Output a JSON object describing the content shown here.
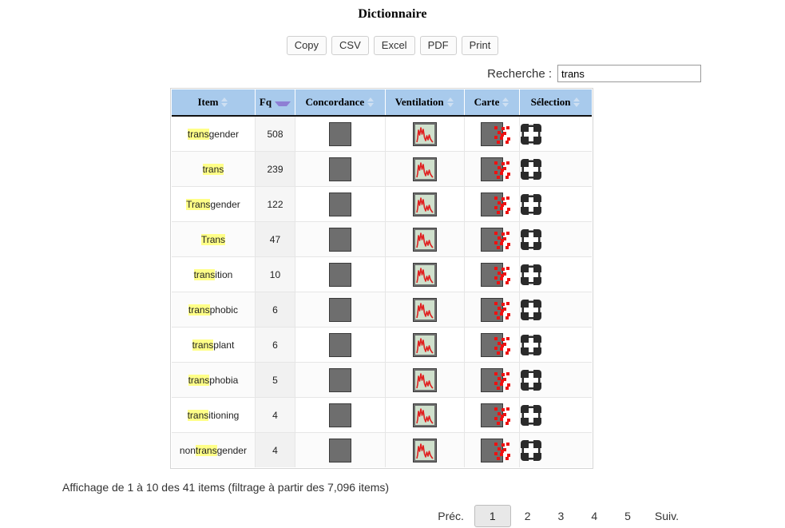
{
  "page": {
    "title": "Dictionnaire"
  },
  "toolbar": {
    "buttons": [
      {
        "label": "Copy",
        "name": "copy-button"
      },
      {
        "label": "CSV",
        "name": "csv-button"
      },
      {
        "label": "Excel",
        "name": "excel-button"
      },
      {
        "label": "PDF",
        "name": "pdf-button"
      },
      {
        "label": "Print",
        "name": "print-button"
      }
    ]
  },
  "search": {
    "label": "Recherche :",
    "value": "trans",
    "placeholder": ""
  },
  "table": {
    "columns": [
      {
        "label": "Item",
        "sort": "both"
      },
      {
        "label": "Fq",
        "sort": "desc"
      },
      {
        "label": "Concordance",
        "sort": "both"
      },
      {
        "label": "Ventilation",
        "sort": "both"
      },
      {
        "label": "Carte",
        "sort": "both"
      },
      {
        "label": "Sélection",
        "sort": "both"
      }
    ],
    "highlight_term": "trans",
    "rows": [
      {
        "item_pre": "",
        "item_hl": "trans",
        "item_post": "gender",
        "fq": "508"
      },
      {
        "item_pre": "",
        "item_hl": "trans",
        "item_post": "",
        "fq": "239"
      },
      {
        "item_pre": "",
        "item_hl": "Trans",
        "item_post": "gender",
        "fq": "122"
      },
      {
        "item_pre": "",
        "item_hl": "Trans",
        "item_post": "",
        "fq": "47"
      },
      {
        "item_pre": "",
        "item_hl": "trans",
        "item_post": "ition",
        "fq": "10"
      },
      {
        "item_pre": "",
        "item_hl": "trans",
        "item_post": "phobic",
        "fq": "6"
      },
      {
        "item_pre": "",
        "item_hl": "trans",
        "item_post": "plant",
        "fq": "6"
      },
      {
        "item_pre": "",
        "item_hl": "trans",
        "item_post": "phobia",
        "fq": "5"
      },
      {
        "item_pre": "",
        "item_hl": "trans",
        "item_post": "itioning",
        "fq": "4"
      },
      {
        "item_pre": "non",
        "item_hl": "trans",
        "item_post": "gender",
        "fq": "4"
      }
    ],
    "icons": {
      "concordance": "concordance-icon",
      "ventilation": "ventilation-icon",
      "carte": "carte-icon",
      "selection": "selection-icon"
    }
  },
  "footer": {
    "info": "Affichage de 1 à 10 des 41 items (filtrage à partir des 7,096 items)",
    "pagination": {
      "previous": "Préc.",
      "next": "Suiv.",
      "pages": [
        "1",
        "2",
        "3",
        "4",
        "5"
      ],
      "current": "1"
    }
  },
  "colors": {
    "header_blue": "#a8caec",
    "highlight_yellow": "#ffff88",
    "accent_red": "#ee1111",
    "sort_arrow": "#8e7fd4"
  }
}
